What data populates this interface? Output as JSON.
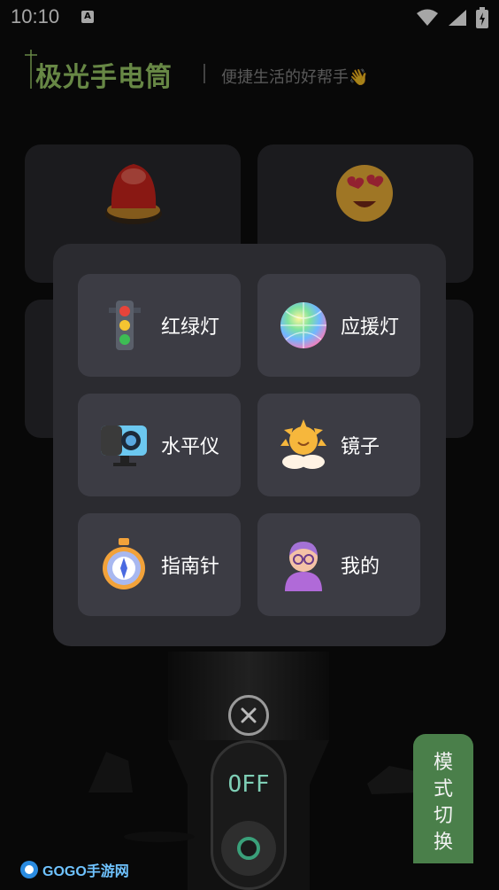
{
  "status_bar": {
    "time": "10:10",
    "notification_glyph": "A",
    "icons": [
      "wifi-icon",
      "signal-icon",
      "battery-icon"
    ]
  },
  "header": {
    "title": "极光手电筒",
    "slogan": "便捷生活的好帮手👋"
  },
  "menu": {
    "items": [
      {
        "label": "红绿灯",
        "icon": "traffic-light-icon"
      },
      {
        "label": "应援灯",
        "icon": "cheer-ball-icon"
      },
      {
        "label": "水平仪",
        "icon": "level-camera-icon"
      },
      {
        "label": "镜子",
        "icon": "sun-mirror-icon"
      },
      {
        "label": "指南针",
        "icon": "compass-icon"
      },
      {
        "label": "我的",
        "icon": "profile-avatar-icon"
      }
    ]
  },
  "flashlight": {
    "switch_label": "OFF"
  },
  "mode_button": {
    "label": "模式切换"
  },
  "watermark": {
    "text": "GOGO手游网"
  },
  "colors": {
    "title_green": "#9ecf6b",
    "panel_bg": "#2b2b30",
    "item_bg": "#3c3c44",
    "mode_button_green": "#4a7f4a",
    "switch_text": "#7fcfb6"
  }
}
